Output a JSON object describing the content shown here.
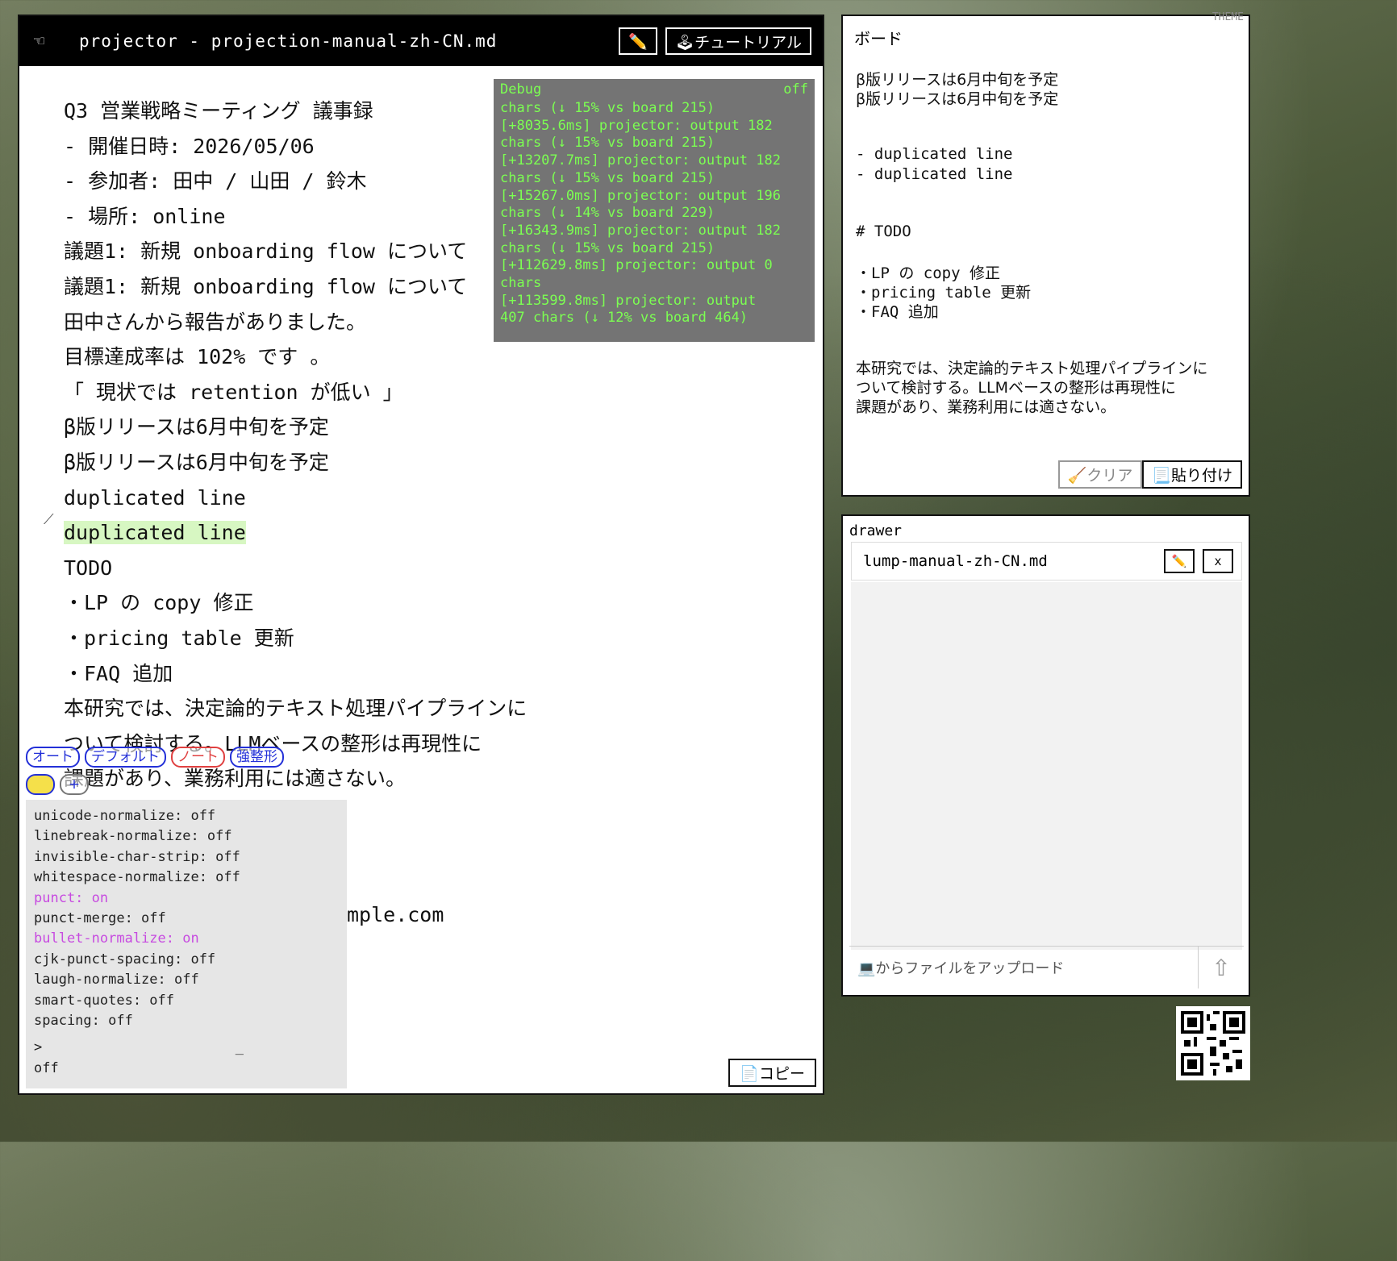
{
  "main": {
    "title": "projector - projection-manual-zh-CN.md",
    "edit_icon": "✏️",
    "tutorial_label": "🕹チュートリアル",
    "doc_lines": [
      "Q3 営業戦略ミーティング 議事録",
      "- 開催日時: 2026/05/06",
      "- 参加者: 田中 / 山田 / 鈴木",
      "- 場所: online",
      "議題1: 新規 onboarding flow について",
      "議題1: 新規 onboarding flow について",
      "田中さんから報告がありました。",
      "目標達成率は 102% です 。",
      "「 現状では retention が低い 」",
      "β版リリースは6月中旬を予定",
      "β版リリースは6月中旬を予定",
      "duplicated line",
      "duplicated line",
      "TODO",
      "・LP の copy 修正",
      "・pricing table 更新",
      "・FAQ 追加",
      "本研究では、決定論的テキスト処理パイプラインに",
      "ついて検討する。LLMベースの整形は再現性に",
      "課題があり、業務利用には適さない。"
    ],
    "highlight_index": 12,
    "email_tail": "mple.com",
    "copy_label": "📄コピー"
  },
  "debug": {
    "title": "Debug",
    "state": "off",
    "lines": [
      "chars (↓ 15% vs board 215)",
      "[+8035.6ms] projector: output 182",
      "chars (↓ 15% vs board 215)",
      "[+13207.7ms] projector: output 182",
      "chars (↓ 15% vs board 215)",
      "[+15267.0ms] projector: output 196",
      "chars (↓ 14% vs board 229)",
      "[+16343.9ms] projector: output 182",
      "chars (↓ 15% vs board 215)",
      "[+112629.8ms] projector: output 0",
      "chars",
      "[+113599.8ms] projector: output",
      "407 chars (↓ 12% vs board 464)"
    ]
  },
  "modes": {
    "auto": "オート",
    "default": "デフォルト",
    "note": "ノート",
    "strong": "強整形",
    "add": "+"
  },
  "settings": {
    "items": [
      {
        "text": "unicode-normalize: off",
        "on": false
      },
      {
        "text": "linebreak-normalize: off",
        "on": false
      },
      {
        "text": "invisible-char-strip: off",
        "on": false
      },
      {
        "text": "whitespace-normalize: off",
        "on": false
      },
      {
        "text": "punct: on",
        "on": true
      },
      {
        "text": "punct-merge: off",
        "on": false
      },
      {
        "text": "bullet-normalize: on",
        "on": true
      },
      {
        "text": "cjk-punct-spacing: off",
        "on": false
      },
      {
        "text": "laugh-normalize: off",
        "on": false
      },
      {
        "text": "smart-quotes: off",
        "on": false
      },
      {
        "text": "spacing: off",
        "on": false
      }
    ],
    "prompt": ">",
    "cursor": "_",
    "footer": "off"
  },
  "board": {
    "title": "ボード",
    "theme": "THEME",
    "line1": "β版リリースは6月中旬を予定",
    "line2": "β版リリースは6月中旬を予定",
    "line3": "- duplicated line",
    "line4": "- duplicated line",
    "line5": "# TODO",
    "line6": "・LP の copy 修正",
    "line7": "・pricing table 更新",
    "line8": "・FAQ 追加",
    "line9": "本研究では、決定論的テキスト処理パイプラインに",
    "line10": "ついて検討する。LLMベースの整形は再現性に",
    "line11": "課題があり、業務利用には適さない。",
    "clear_label": "🧹クリア",
    "paste_label": "📃貼り付け"
  },
  "drawer": {
    "title": "drawer",
    "file_name": "lump-manual-zh-CN.md",
    "edit_icon": "✏️",
    "close_label": "x",
    "upload_label": "💻からファイルをアップロード",
    "upload_arrow": "⇧"
  }
}
